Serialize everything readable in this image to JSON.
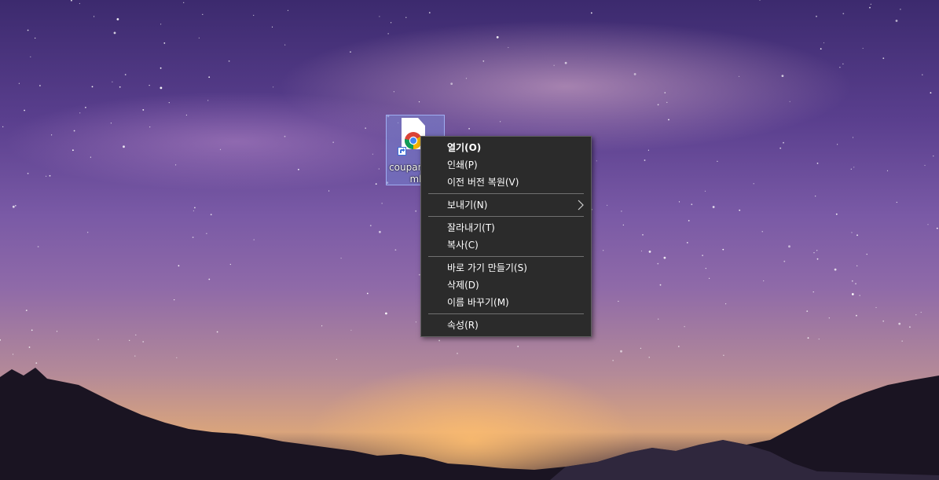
{
  "desktop": {
    "icon": {
      "label": "coupang.html",
      "icon": "chrome-html-file-icon",
      "overlay": "shortcut-arrow-icon"
    }
  },
  "context_menu": {
    "items": [
      {
        "label": "열기(O)",
        "bold": true
      },
      {
        "label": "인쇄(P)"
      },
      {
        "label": "이전 버전 복원(V)"
      },
      {
        "separator": true
      },
      {
        "label": "보내기(N)",
        "submenu": true
      },
      {
        "separator": true
      },
      {
        "label": "잘라내기(T)"
      },
      {
        "label": "복사(C)"
      },
      {
        "separator": true
      },
      {
        "label": "바로 가기 만들기(S)"
      },
      {
        "label": "삭제(D)"
      },
      {
        "label": "이름 바꾸기(M)"
      },
      {
        "separator": true
      },
      {
        "label": "속성(R)"
      }
    ]
  },
  "colors": {
    "menu_background": "#2b2b2b",
    "menu_text": "#ffffff",
    "icon_selection": "#788cdc"
  }
}
